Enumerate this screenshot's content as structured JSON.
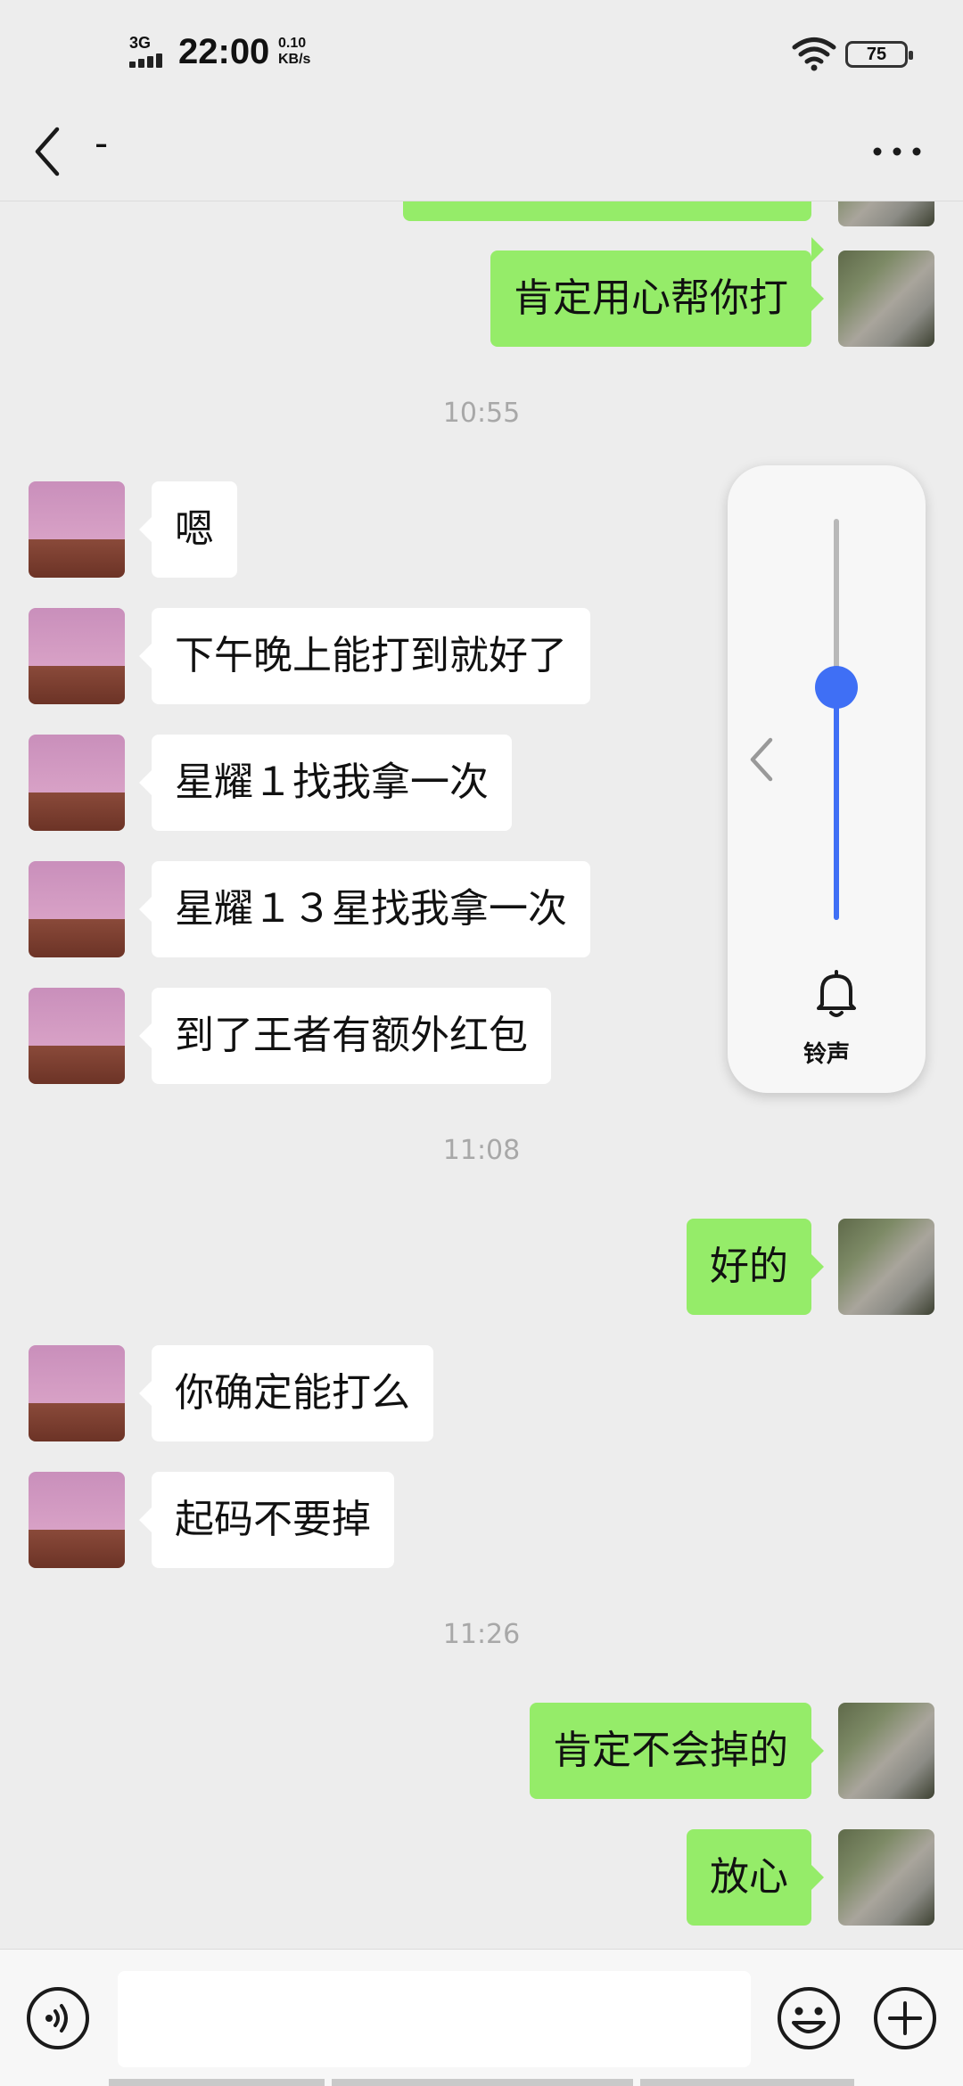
{
  "status": {
    "network": "3G",
    "time": "22:00",
    "speed_value": "0.10",
    "speed_unit": "KB/s",
    "battery": "75"
  },
  "header": {
    "title": "-"
  },
  "messages": [
    {
      "side": "right",
      "text": "肯定用心帮你打"
    },
    {
      "time": "10:55"
    },
    {
      "side": "left",
      "text": "嗯"
    },
    {
      "side": "left",
      "text": "下午晚上能打到就好了"
    },
    {
      "side": "left",
      "text": "星耀１找我拿一次"
    },
    {
      "side": "left",
      "text": "星耀１３星找我拿一次"
    },
    {
      "side": "left",
      "text": "到了王者有额外红包"
    },
    {
      "time": "11:08"
    },
    {
      "side": "right",
      "text": "好的"
    },
    {
      "side": "left",
      "text": "你确定能打么"
    },
    {
      "side": "left",
      "text": "起码不要掉"
    },
    {
      "time": "11:26"
    },
    {
      "side": "right",
      "text": "肯定不会掉的"
    },
    {
      "side": "right",
      "text": "放心"
    }
  ],
  "volume_panel": {
    "label": "铃声",
    "level": 0.58,
    "accent_color": "#3f6ff5"
  },
  "input": {
    "value": "",
    "voice_icon": "voice-icon",
    "emoji_icon": "emoji-icon",
    "plus_icon": "plus-icon"
  },
  "colors": {
    "outgoing_bubble": "#95ec69",
    "incoming_bubble": "#ffffff",
    "background": "#ededed"
  }
}
